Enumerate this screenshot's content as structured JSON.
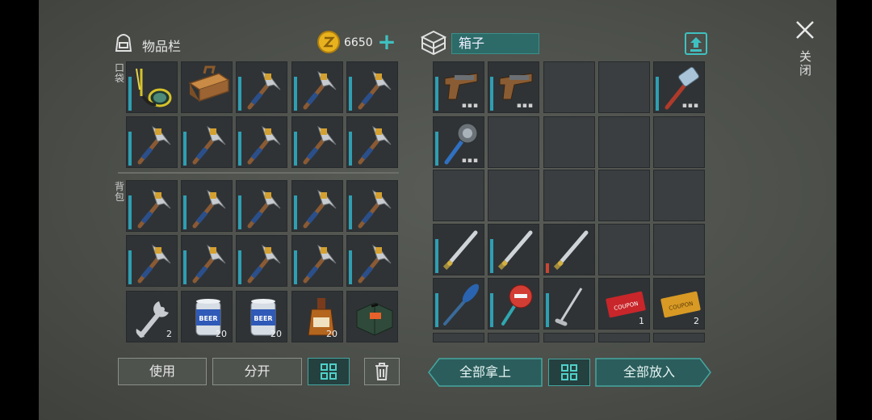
{
  "inventory": {
    "title": "物品栏",
    "coins": "6650",
    "pocket_label": "口袋",
    "backpack_label": "背包"
  },
  "buttons": {
    "use": "使用",
    "split": "分开",
    "take_all": "全部拿上",
    "put_all": "全部放入"
  },
  "chest": {
    "title": "箱子"
  },
  "close_label": "关闭",
  "left_counts": {
    "wrench": "2",
    "beer1": "20",
    "beer2": "20",
    "whiskey": "20"
  },
  "right_counts": {
    "coupon_red": "1",
    "coupon_gold": "2"
  },
  "coupon_text": "COUPON",
  "beer_text": "BEER",
  "colors": {
    "accent": "#2f9fb2",
    "teal_button": "#2b5d5c",
    "coin": "#e8b21e"
  }
}
